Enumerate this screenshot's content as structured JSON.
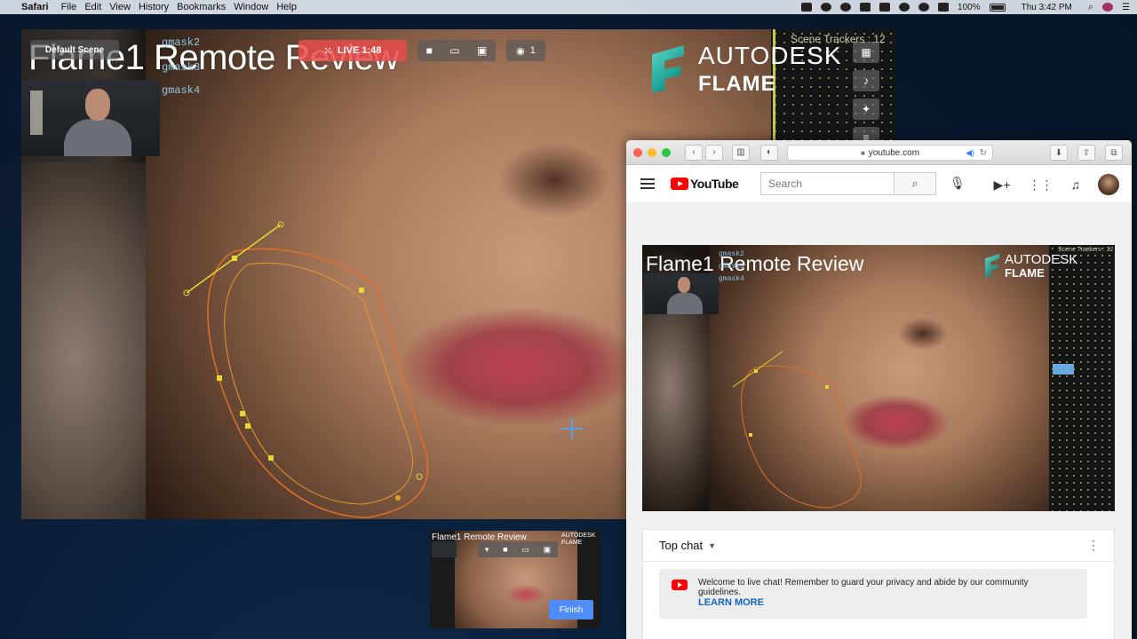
{
  "menubar": {
    "app": "Safari",
    "items": [
      "File",
      "Edit",
      "View",
      "History",
      "Bookmarks",
      "Window",
      "Help"
    ],
    "battery": "100%",
    "clock": "Thu 3:42 PM"
  },
  "flame": {
    "title": "Flame1 Remote Review",
    "scene": "Default Scene",
    "gmasks": [
      "gmask2",
      "gmask3",
      "gmask4"
    ],
    "live_label": "LIVE 1:48",
    "viewers": "1",
    "logo_line1": "AUTODESK",
    "logo_line2": "FLAME",
    "trackers_label": "Scene Trackers : 12"
  },
  "mini": {
    "title": "Flame1 Remote Review",
    "logo": "AUTODESK FLAME",
    "finish_label": "Finish"
  },
  "safari": {
    "url": "youtube.com"
  },
  "youtube": {
    "logo": "YouTube",
    "search_placeholder": "Search",
    "video_title": "Flame1 Remote Review",
    "video_logo1": "AUTODESK",
    "video_logo2": "FLAME",
    "video_gmasks": [
      "gmask2",
      "gmask3",
      "gmask4"
    ],
    "video_trackers": "Scene Trackers : 12",
    "chat": {
      "header": "Top chat",
      "welcome": "Welcome to live chat! Remember to guard your privacy and abide by our community guidelines.",
      "learn_more": "LEARN MORE"
    }
  },
  "colors": {
    "live_red": "#e84b4b",
    "flame_teal": "#1fa79b",
    "spline_orange": "#e0702a",
    "spline_yellow": "#e6d830",
    "finish_blue": "#4f8cf5",
    "link_blue": "#1665c1"
  }
}
